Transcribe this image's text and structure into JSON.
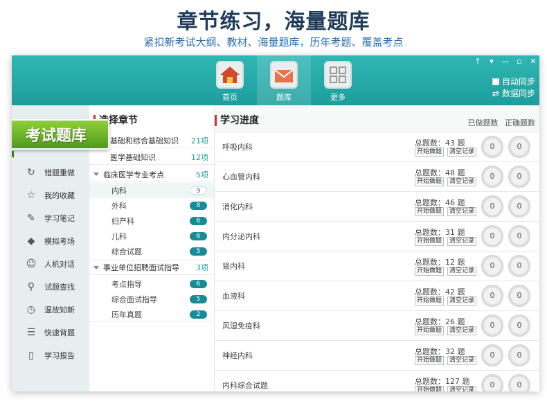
{
  "promo": {
    "title": "章节练习，海量题库",
    "subtitle": "紧扣新考试大纲、教材、海量题库，历年考题、覆盖考点"
  },
  "window_controls": [
    "↑",
    "▾",
    "—",
    "▫",
    "✕"
  ],
  "topnav": [
    {
      "label": "首页",
      "icon": "home-icon"
    },
    {
      "label": "题库",
      "icon": "envelope-icon"
    },
    {
      "label": "更多",
      "icon": "grid-icon"
    }
  ],
  "sync": {
    "auto": "自动同步",
    "data": "数据同步"
  },
  "badge": "考试题库",
  "sidebar": [
    {
      "label": "错题重做",
      "icon": "redo-icon",
      "glyph": "↻"
    },
    {
      "label": "我的收藏",
      "icon": "star-icon",
      "glyph": "☆"
    },
    {
      "label": "学习笔记",
      "icon": "edit-icon",
      "glyph": "✎"
    },
    {
      "label": "模拟考场",
      "icon": "graduation-cap-icon",
      "glyph": "◆"
    },
    {
      "label": "人机对话",
      "icon": "chat-icon",
      "glyph": "☺"
    },
    {
      "label": "试题查找",
      "icon": "search-icon",
      "glyph": "⚲"
    },
    {
      "label": "温故知新",
      "icon": "clock-icon",
      "glyph": "◷"
    },
    {
      "label": "快速背题",
      "icon": "list-icon",
      "glyph": "☰"
    },
    {
      "label": "学习报告",
      "icon": "book-icon",
      "glyph": "▯"
    }
  ],
  "chapters": {
    "header": "选择章节",
    "groups": [
      {
        "label": "基础和综合基础知识",
        "count": "21项",
        "items": []
      },
      {
        "label": "医学基础知识",
        "count": "12项",
        "items": []
      },
      {
        "label": "临床医学专业考点",
        "count": "5项",
        "items": [
          {
            "label": "内科",
            "count": "9"
          },
          {
            "label": "外科",
            "count": "8"
          },
          {
            "label": "妇产科",
            "count": "6"
          },
          {
            "label": "儿科",
            "count": "6"
          },
          {
            "label": "综合试题",
            "count": "5"
          }
        ]
      },
      {
        "label": "事业单位招聘面试指导",
        "count": "3项",
        "items": [
          {
            "label": "考点指导",
            "count": "6"
          },
          {
            "label": "综合面试指导",
            "count": "5"
          },
          {
            "label": "历年真题",
            "count": "2"
          }
        ]
      }
    ]
  },
  "progress": {
    "header": "学习进度",
    "col_done": "已做题数",
    "col_correct": "正确题数",
    "start_label": "开始做题",
    "clear_label": "清空记录",
    "rows": [
      {
        "name": "呼吸内科",
        "total": "总题数：43 题",
        "done": "0",
        "correct": "0"
      },
      {
        "name": "心血管内科",
        "total": "总题数：48 题",
        "done": "0",
        "correct": "0"
      },
      {
        "name": "消化内科",
        "total": "总题数：46 题",
        "done": "0",
        "correct": "0"
      },
      {
        "name": "内分泌内科",
        "total": "总题数：31 题",
        "done": "0",
        "correct": "0"
      },
      {
        "name": "肾内科",
        "total": "总题数：12 题",
        "done": "0",
        "correct": "0"
      },
      {
        "name": "血液科",
        "total": "总题数：42 题",
        "done": "0",
        "correct": "0"
      },
      {
        "name": "风湿免疫科",
        "total": "总题数：26 题",
        "done": "0",
        "correct": "0"
      },
      {
        "name": "神经内科",
        "total": "总题数：32 题",
        "done": "0",
        "correct": "0"
      },
      {
        "name": "内科综合试题",
        "total": "总题数：127 题",
        "done": "0",
        "correct": "0"
      }
    ]
  }
}
